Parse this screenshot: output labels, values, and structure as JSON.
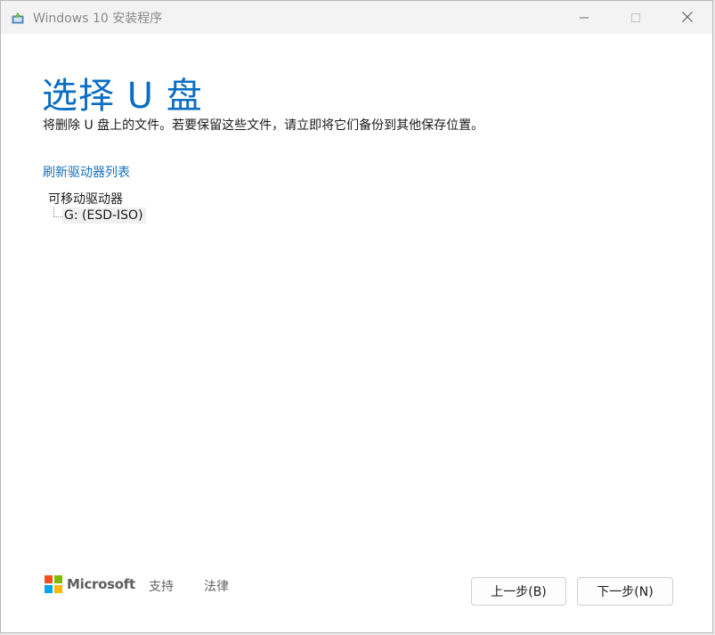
{
  "window": {
    "title": "Windows 10 安装程序"
  },
  "page": {
    "title": "选择 U 盘",
    "subtitle": "将删除 U 盘上的文件。若要保留这些文件，请立即将它们备份到其他保存位置。",
    "refresh_link": "刷新驱动器列表"
  },
  "drives": {
    "group_label": "可移动驱动器",
    "items": [
      {
        "label": "G: (ESD-ISO)"
      }
    ]
  },
  "footer": {
    "brand": "Microsoft",
    "support_label": "支持",
    "legal_label": "法律",
    "back_label": "上一步(B)",
    "next_label": "下一步(N)"
  },
  "colors": {
    "accent": "#0a6fc2",
    "link": "#1470bd",
    "ms_red": "#f25022",
    "ms_green": "#7fba00",
    "ms_blue": "#00a4ef",
    "ms_yellow": "#ffb900"
  },
  "icons": {
    "app": "setup-app-icon",
    "minimize": "minimize-icon",
    "maximize": "maximize-icon",
    "close": "close-icon"
  }
}
